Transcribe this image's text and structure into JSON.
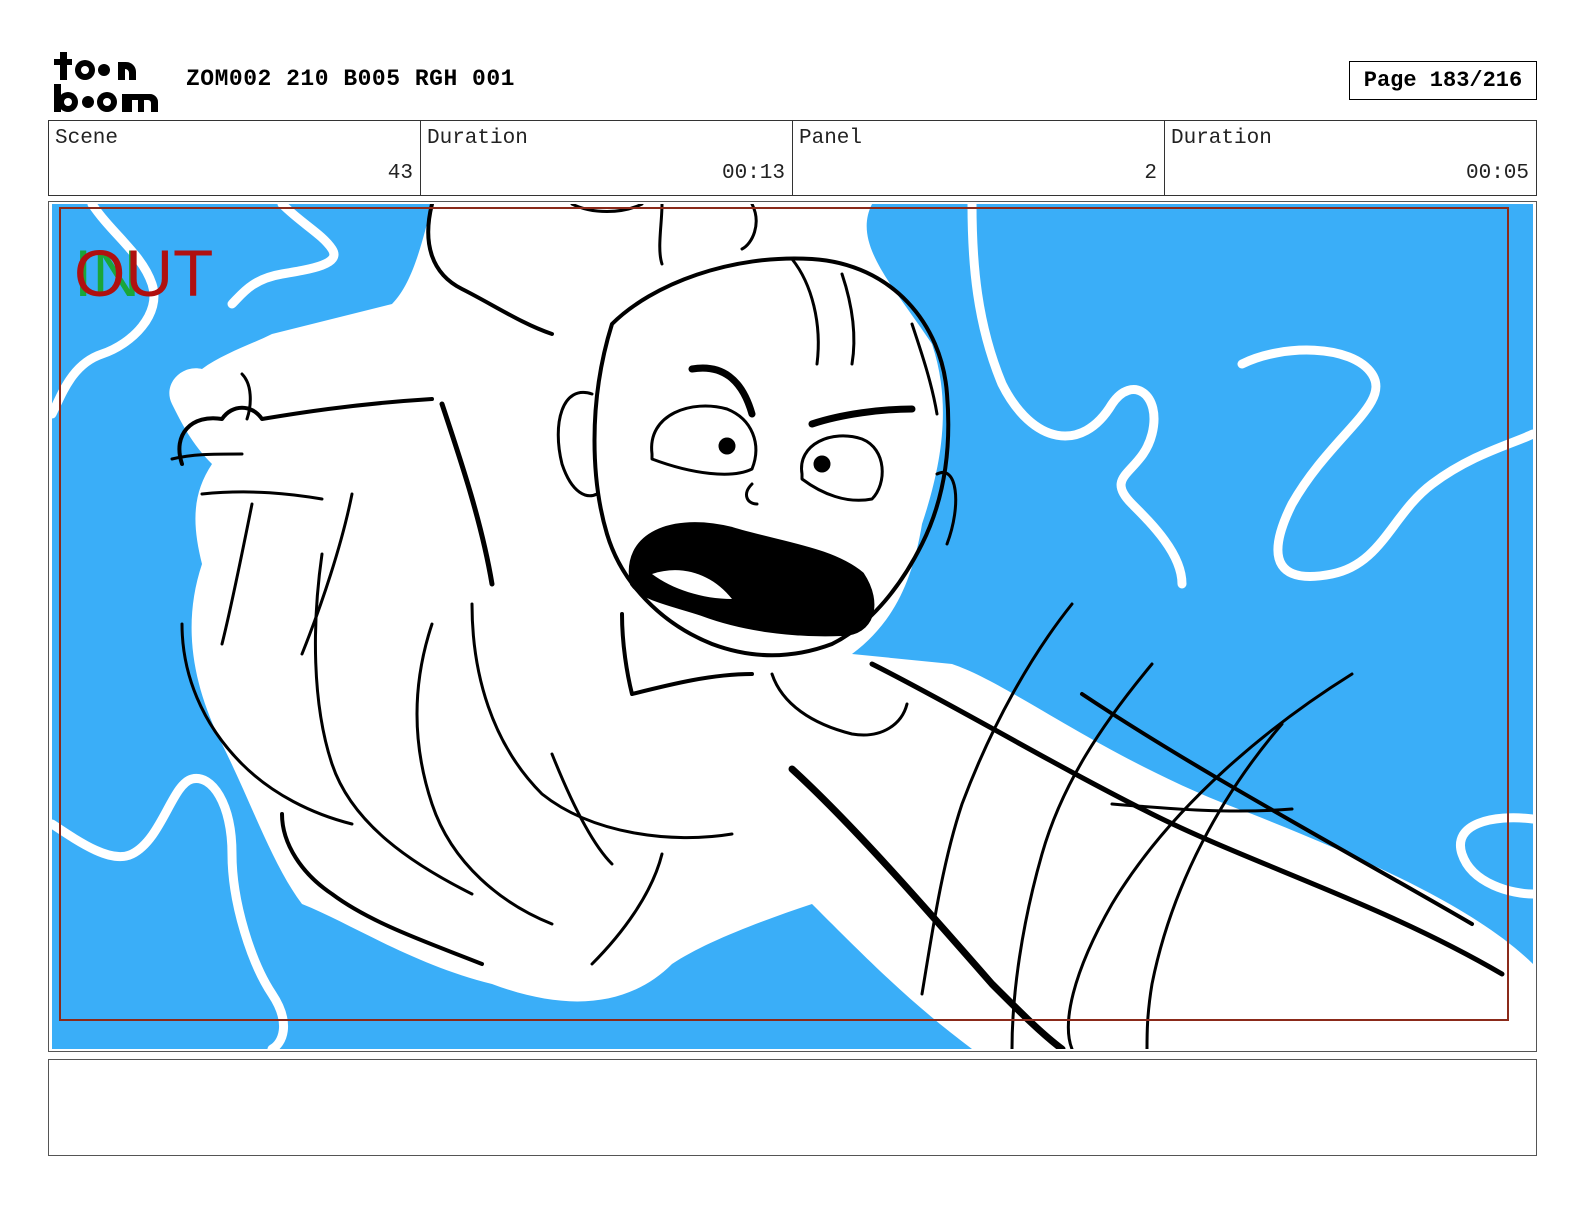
{
  "header": {
    "logo_text": "toon boom",
    "title": "ZOM002 210 B005 RGH 001",
    "page": "Page 183/216"
  },
  "info": [
    {
      "label": "Scene",
      "value": "43"
    },
    {
      "label": "Duration",
      "value": "00:13"
    },
    {
      "label": "Panel",
      "value": "2"
    },
    {
      "label": "Duration",
      "value": "00:05"
    }
  ],
  "panel": {
    "in_label": "IN",
    "out_label": "OUT",
    "colors": {
      "sky": "#3aaef8",
      "ink": "#000000",
      "safe_frame": "#8b2a1a",
      "in_color": "#1aa63a",
      "out_color": "#b01010"
    }
  },
  "notes": {
    "text": ""
  }
}
